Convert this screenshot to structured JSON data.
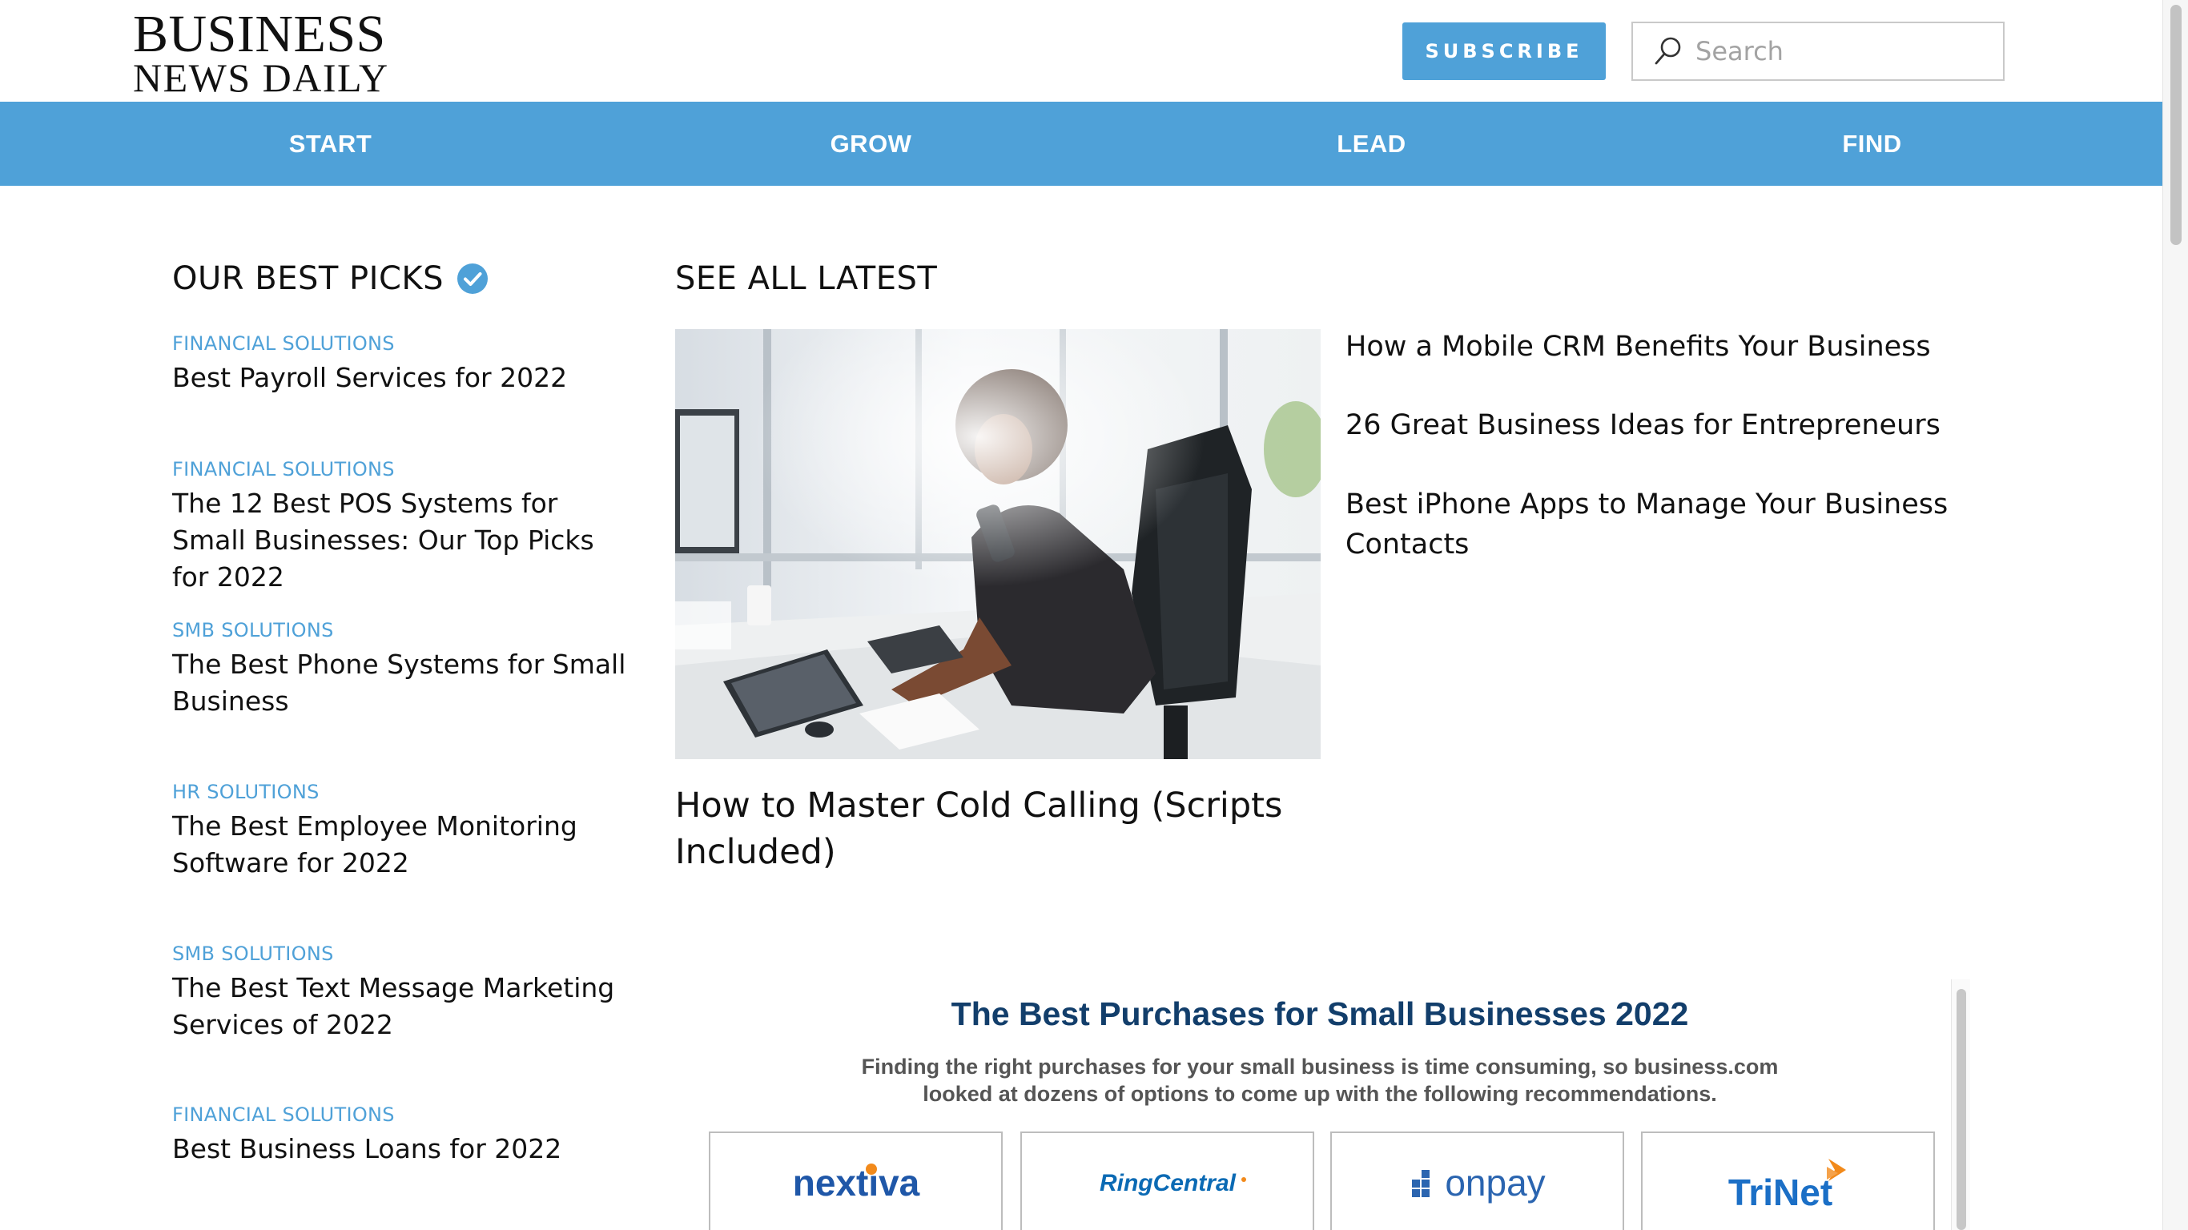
{
  "header": {
    "logo_line1": "BUSINESS",
    "logo_line2": "NEWS DAILY",
    "subscribe_label": "SUBSCRIBE",
    "search_placeholder": "Search"
  },
  "nav": {
    "items": [
      {
        "label": "START"
      },
      {
        "label": "GROW"
      },
      {
        "label": "LEAD"
      },
      {
        "label": "FIND"
      }
    ]
  },
  "best_picks": {
    "title": "OUR BEST PICKS",
    "items": [
      {
        "category": "FINANCIAL SOLUTIONS",
        "title": "Best Payroll Services for 2022"
      },
      {
        "category": "FINANCIAL SOLUTIONS",
        "title": "The 12 Best POS Systems for Small Businesses: Our Top Picks for 2022"
      },
      {
        "category": "SMB SOLUTIONS",
        "title": "The Best Phone Systems for Small Business"
      },
      {
        "category": "HR SOLUTIONS",
        "title": "The Best Employee Monitoring Software for 2022"
      },
      {
        "category": "SMB SOLUTIONS",
        "title": "The Best Text Message Marketing Services of 2022"
      },
      {
        "category": "FINANCIAL SOLUTIONS",
        "title": "Best Business Loans for 2022"
      }
    ]
  },
  "latest": {
    "title": "SEE ALL LATEST",
    "featured_caption": "How to Master Cold Calling (Scripts Included)",
    "links": [
      "How a Mobile CRM Benefits Your Business",
      "26 Great Business Ideas for Entrepreneurs",
      "Best iPhone Apps to Manage Your Business Contacts"
    ]
  },
  "widget": {
    "title": "The Best Purchases for Small Businesses 2022",
    "subtitle_line1": "Finding the right purchases for your small business is time consuming, so business.com",
    "subtitle_line2": "looked at dozens of options to come up with the following recommendations.",
    "vendors": [
      "nextiva",
      "RingCentral",
      "onpay",
      "TriNet"
    ]
  },
  "colors": {
    "brand_blue": "#4fa1d8",
    "widget_title": "#123e6b"
  }
}
